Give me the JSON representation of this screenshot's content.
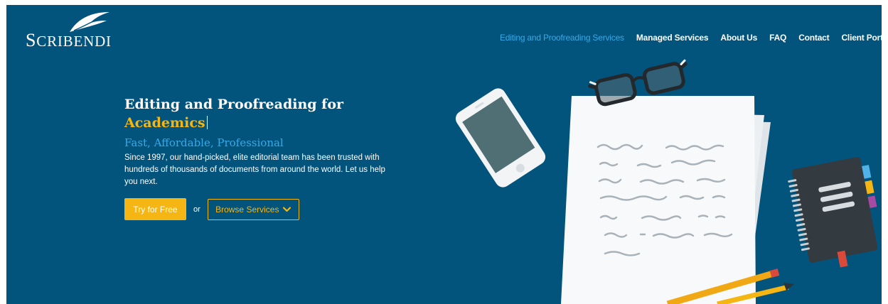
{
  "brand": {
    "name_initial": "S",
    "name_rest": "CRIBENDI"
  },
  "nav": {
    "items": [
      {
        "label": "Editing and Proofreading Services",
        "active": true
      },
      {
        "label": "Managed Services",
        "active": false
      },
      {
        "label": "About Us",
        "active": false
      },
      {
        "label": "FAQ",
        "active": false
      },
      {
        "label": "Contact",
        "active": false
      },
      {
        "label": "Client Portal",
        "active": false
      }
    ]
  },
  "hero": {
    "headline": "Editing and Proofreading for",
    "headline_accent": "Academics",
    "tagline": "Fast, Affordable, Professional",
    "description": "Since 1997, our hand-picked, elite editorial team has been trusted with hundreds of thousands of documents from around the world. Let us help you next.",
    "primary_button": "Try for Free",
    "separator": "or",
    "secondary_button": "Browse Services"
  },
  "colors": {
    "background": "#03547c",
    "accent_yellow": "#f5b613",
    "accent_blue": "#36a9e8",
    "text": "#ffffff"
  },
  "icons": {
    "logo": "feather-icon",
    "browse_chevron": "chevron-down-icon"
  }
}
